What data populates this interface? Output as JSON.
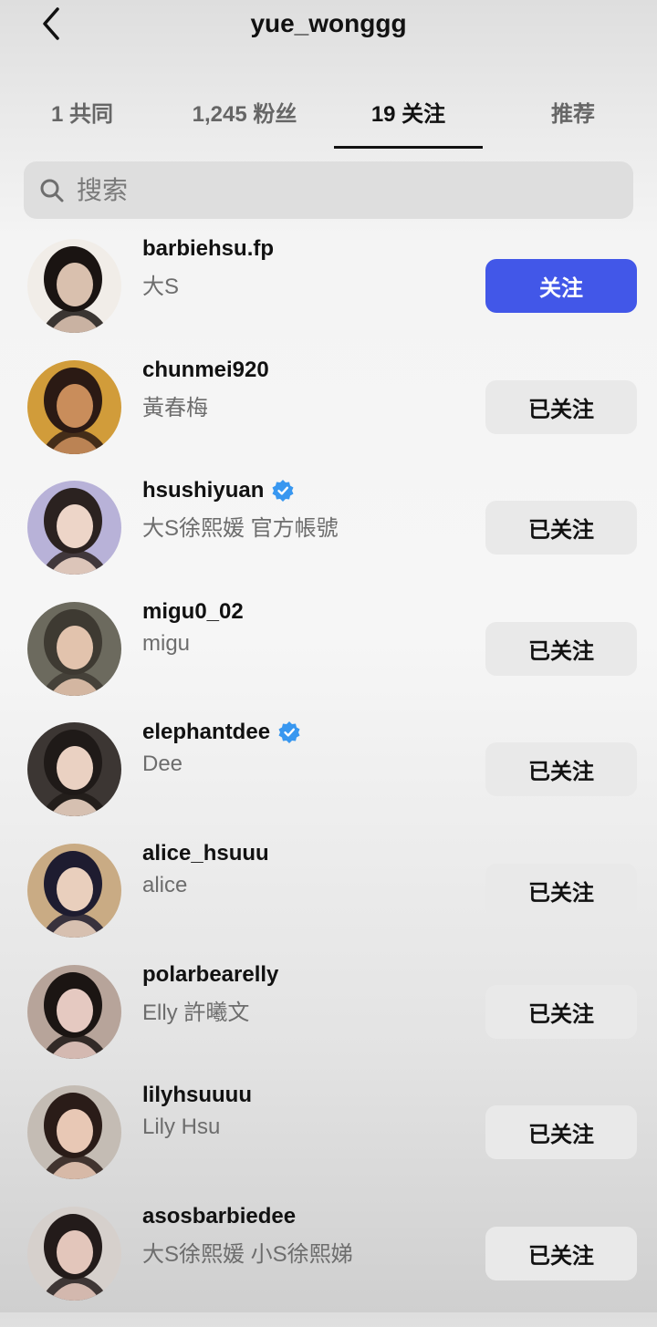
{
  "header": {
    "title": "yue_wonggg",
    "back_icon": "chevron-left-icon"
  },
  "tabs": [
    {
      "label": "1 共同"
    },
    {
      "label": "1,245 粉丝"
    },
    {
      "label": "19 关注",
      "active": true
    },
    {
      "label": "推荐"
    }
  ],
  "search": {
    "placeholder": "搜索",
    "icon": "search-icon"
  },
  "colors": {
    "follow_button": "#4257e8",
    "following_button": "#e9e9e9",
    "verified_badge": "#3897f0"
  },
  "users": [
    {
      "username": "barbiehsu.fp",
      "display_name": "大S",
      "verified": false,
      "button": "关注"
    },
    {
      "username": "chunmei920",
      "display_name": "黃春梅",
      "verified": false,
      "button": "已关注"
    },
    {
      "username": "hsushiyuan",
      "display_name": "大S徐熙媛 官方帳號",
      "verified": true,
      "button": "已关注"
    },
    {
      "username": "migu0_02",
      "display_name": "migu",
      "verified": false,
      "button": "已关注"
    },
    {
      "username": "elephantdee",
      "display_name": "Dee",
      "verified": true,
      "button": "已关注"
    },
    {
      "username": "alice_hsuuu",
      "display_name": "alice",
      "verified": false,
      "button": "已关注"
    },
    {
      "username": "polarbearelly",
      "display_name": "Elly 許曦文",
      "verified": false,
      "button": "已关注"
    },
    {
      "username": "lilyhsuuuu",
      "display_name": "Lily Hsu",
      "verified": false,
      "button": "已关注"
    },
    {
      "username": "asosbarbiedee",
      "display_name": "大S徐熙媛 小S徐熙娣",
      "verified": false,
      "button": "已关注"
    }
  ]
}
